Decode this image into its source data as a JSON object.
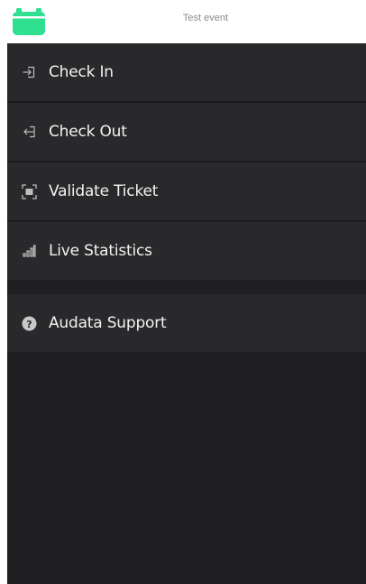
{
  "header": {
    "event_title": "Test event",
    "logo_icon": "calendar-icon",
    "accent_color": "#2ee08f"
  },
  "menu": {
    "items": [
      {
        "label": "Check In",
        "icon": "check-in-icon"
      },
      {
        "label": "Check Out",
        "icon": "check-out-icon"
      },
      {
        "label": "Validate Ticket",
        "icon": "scan-icon"
      },
      {
        "label": "Live Statistics",
        "icon": "bar-chart-icon"
      }
    ],
    "support": {
      "label": "Audata Support",
      "icon": "help-icon"
    }
  }
}
